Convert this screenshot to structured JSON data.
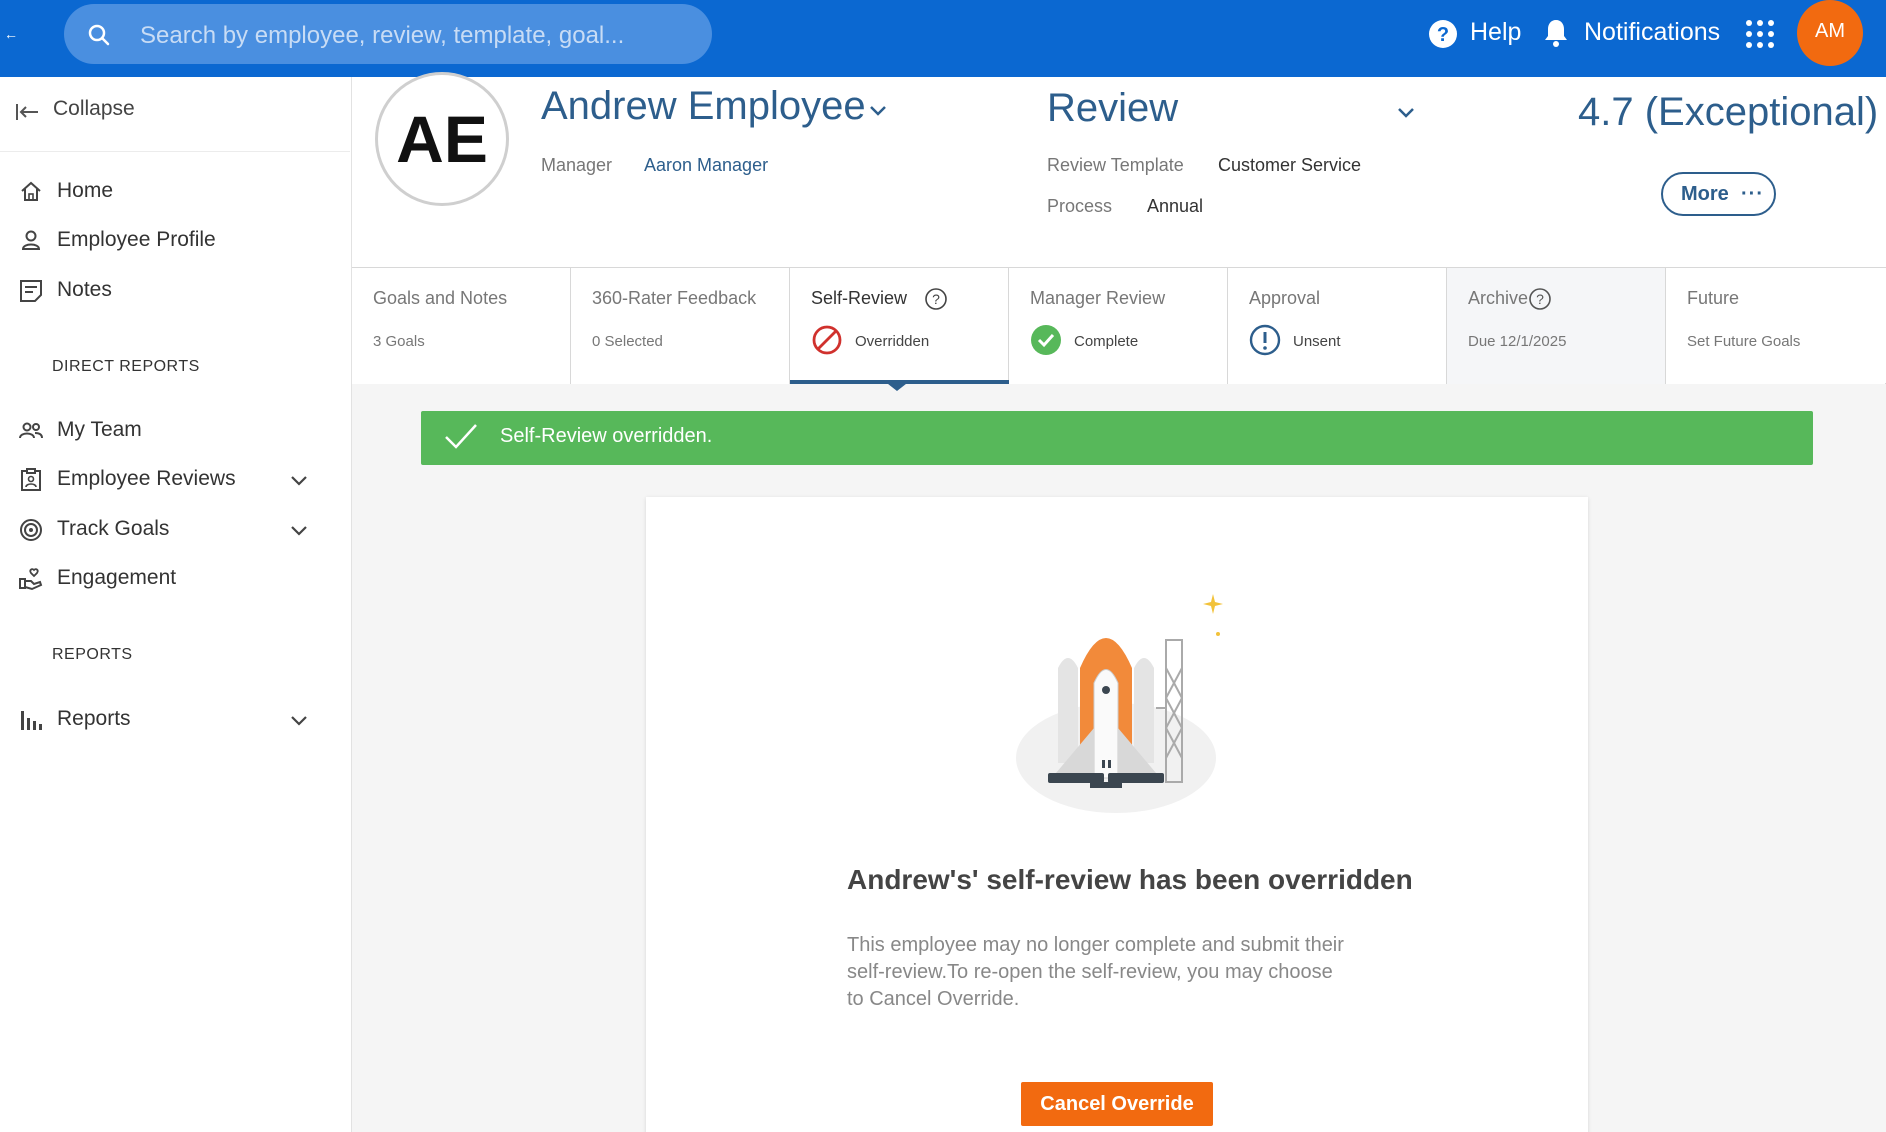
{
  "topbar": {
    "back_glyph": "←",
    "search_placeholder": "Search by employee, review, template, goal...",
    "help_label": "Help",
    "notifications_label": "Notifications",
    "user_initials": "AM",
    "brand_color": "#0b68d1",
    "avatar_color": "#f26a10"
  },
  "sidebar": {
    "collapse_label": "Collapse",
    "items": [
      {
        "label": "Home",
        "icon": "home-icon"
      },
      {
        "label": "Employee Profile",
        "icon": "person-icon"
      },
      {
        "label": "Notes",
        "icon": "notes-icon"
      },
      {
        "label": "My Team",
        "icon": "team-icon"
      },
      {
        "label": "Employee Reviews",
        "icon": "clipboard-icon",
        "expandable": true
      },
      {
        "label": "Track Goals",
        "icon": "target-icon",
        "expandable": true
      },
      {
        "label": "Engagement",
        "icon": "engagement-icon"
      },
      {
        "label": "Reports",
        "icon": "bar-chart-icon",
        "expandable": true
      }
    ],
    "sections": {
      "direct_reports": "DIRECT REPORTS",
      "reports": "REPORTS"
    }
  },
  "header": {
    "initials": "AE",
    "employee_name": "Andrew Employee",
    "manager_key": "Manager",
    "manager_value": "Aaron Manager",
    "review_title": "Review",
    "review_template_key": "Review Template",
    "review_template_value": "Customer Service",
    "process_key": "Process",
    "process_value": "Annual",
    "score": "4.7 (Exceptional)",
    "more_label": "More",
    "more_dots": "···"
  },
  "tabs": [
    {
      "title": "Goals and Notes",
      "sub": "3 Goals"
    },
    {
      "title": "360-Rater Feedback",
      "sub": "0 Selected"
    },
    {
      "title": "Self-Review",
      "sub": "Overridden",
      "status": "overridden",
      "active": true
    },
    {
      "title": "Manager Review",
      "sub": "Complete",
      "status": "complete"
    },
    {
      "title": "Approval",
      "sub": "Unsent",
      "status": "unsent"
    },
    {
      "title": "Archive",
      "sub": "Due 12/1/2025"
    },
    {
      "title": "Future",
      "sub": "Set Future Goals"
    }
  ],
  "alert": {
    "message": "Self-Review overridden.",
    "color": "#57b85a"
  },
  "card": {
    "title": "Andrew's' self-review has been overridden",
    "body": "This employee may no longer complete and submit their self-review.To re-open the self-review, you may choose to Cancel Override.",
    "button_label": "Cancel Override",
    "button_color": "#f26a10"
  }
}
